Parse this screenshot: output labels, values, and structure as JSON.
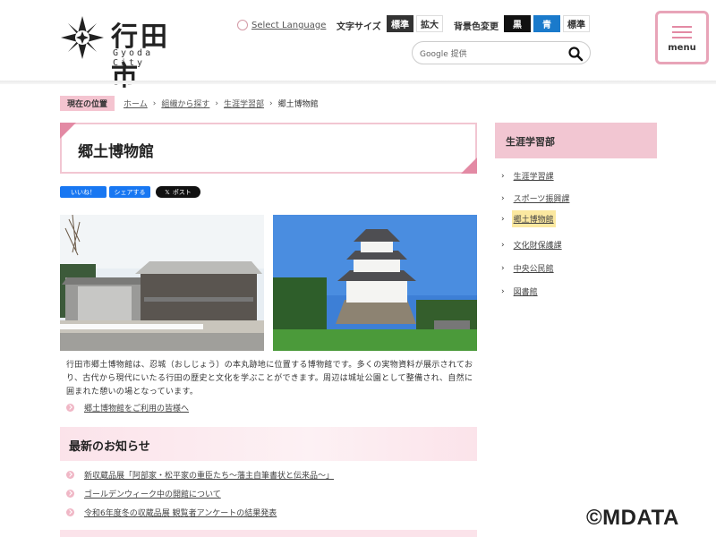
{
  "header": {
    "logo_jp": "行田市",
    "logo_en": "Gyoda City",
    "select_language": "Select Language",
    "text_size_label": "文字サイズ",
    "text_size_standard": "標準",
    "text_size_large": "拡大",
    "bg_color_label": "背景色変更",
    "bg_black": "黒",
    "bg_blue": "青",
    "bg_standard": "標準",
    "search_brand": "Google 提供",
    "search_placeholder": "",
    "menu_label": "menu"
  },
  "breadcrumb": {
    "here_label": "現在の位置",
    "items": [
      "ホーム",
      "組織から探す",
      "生涯学習部"
    ],
    "current": "郷土博物館"
  },
  "main": {
    "page_title": "郷土博物館",
    "sns": {
      "like": "いいね！",
      "share": "シェアする",
      "x_post": "ポスト"
    },
    "description": "行田市郷土博物館は、忍城（おしじょう）の本丸跡地に位置する博物館です。多くの実物資料が展示されており、古代から現代にいたる行田の歴史と文化を学ぶことができます。周辺は城址公園として整備され、自然に囲まれた憩いの場となっています。",
    "guide_link": "郷土博物館をご利用の皆様へ",
    "news_title": "最新のお知らせ",
    "news": [
      "新収蔵品展「阿部家・松平家の重臣たち～藩主自筆書状と伝来品～」",
      "ゴールデンウィーク中の開館について",
      "令和6年度冬の収蔵品展 観覧者アンケートの結果発表"
    ]
  },
  "sidebar": {
    "title": "生涯学習部",
    "items": [
      "生涯学習課",
      "スポーツ振興課",
      "郷土博物館",
      "文化財保護課",
      "中央公民館",
      "図書館"
    ],
    "active_index": 2
  },
  "watermark": "©MDATA",
  "colors": {
    "accent_pink": "#f2c6d2",
    "dark_pink": "#e38aa4",
    "blue": "#1a7acb"
  }
}
